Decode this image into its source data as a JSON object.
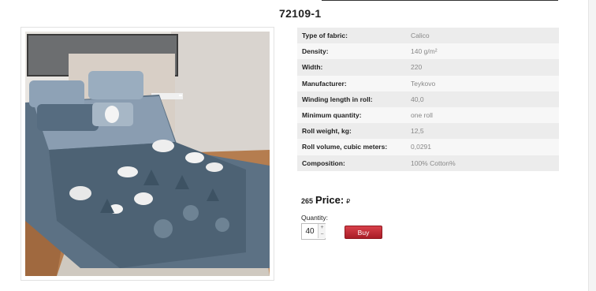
{
  "product": {
    "title": "72109-1"
  },
  "image": {
    "alt": ""
  },
  "specs": [
    {
      "key": "Type of fabric:",
      "value": "Calico"
    },
    {
      "key": "Density:",
      "value": "140 g/m²"
    },
    {
      "key": "Width:",
      "value": "220"
    },
    {
      "key": "Manufacturer:",
      "value": "Teykovo"
    },
    {
      "key": "Winding length in roll:",
      "value": "40,0"
    },
    {
      "key": "Minimum quantity:",
      "value": "one roll"
    },
    {
      "key": "Roll weight, kg:",
      "value": "12,5"
    },
    {
      "key": "Roll volume, cubic meters:",
      "value": "0,0291"
    },
    {
      "key": "Composition:",
      "value": "100% Cotton%"
    }
  ],
  "price": {
    "amount": "265",
    "label": "Price:",
    "currency": "₽"
  },
  "quantity": {
    "label": "Quantity:",
    "value": "40",
    "up_icon": "+",
    "down_icon": "−"
  },
  "buy": {
    "label": "Buy"
  }
}
